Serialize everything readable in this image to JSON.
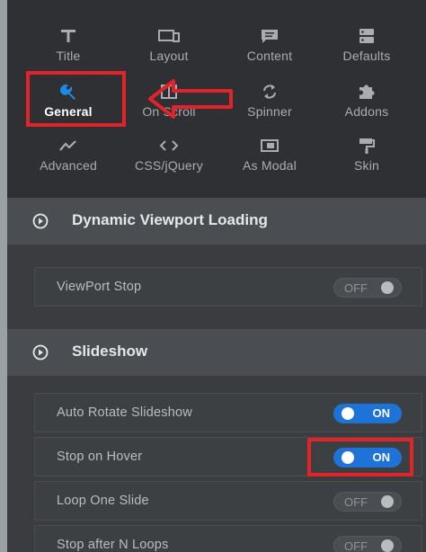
{
  "nav": {
    "items": [
      {
        "label": "Title",
        "icon": "title-icon"
      },
      {
        "label": "Layout",
        "icon": "layout-icon"
      },
      {
        "label": "Content",
        "icon": "content-icon"
      },
      {
        "label": "Defaults",
        "icon": "defaults-icon"
      },
      {
        "label": "General",
        "icon": "wrench-icon",
        "active": true
      },
      {
        "label": "On Scroll",
        "icon": "on-scroll-icon"
      },
      {
        "label": "Spinner",
        "icon": "spinner-icon"
      },
      {
        "label": "Addons",
        "icon": "puzzle-icon"
      },
      {
        "label": "Advanced",
        "icon": "chart-line-icon"
      },
      {
        "label": "CSS/jQuery",
        "icon": "code-icon"
      },
      {
        "label": "As Modal",
        "icon": "modal-icon"
      },
      {
        "label": "Skin",
        "icon": "paint-roller-icon"
      }
    ]
  },
  "sections": {
    "viewport": {
      "title": "Dynamic Viewport Loading",
      "rows": [
        {
          "label": "ViewPort Stop",
          "state": "OFF"
        }
      ]
    },
    "slideshow": {
      "title": "Slideshow",
      "rows": [
        {
          "label": "Auto Rotate Slideshow",
          "state": "ON"
        },
        {
          "label": "Stop on Hover",
          "state": "ON"
        },
        {
          "label": "Loop One Slide",
          "state": "OFF"
        },
        {
          "label": "Stop after N Loops",
          "state": "OFF"
        }
      ]
    }
  },
  "colors": {
    "accent": "#1e73d8",
    "highlight": "#e2232a",
    "panel": "#3a3c3f",
    "nav_bg": "#2e3033"
  }
}
